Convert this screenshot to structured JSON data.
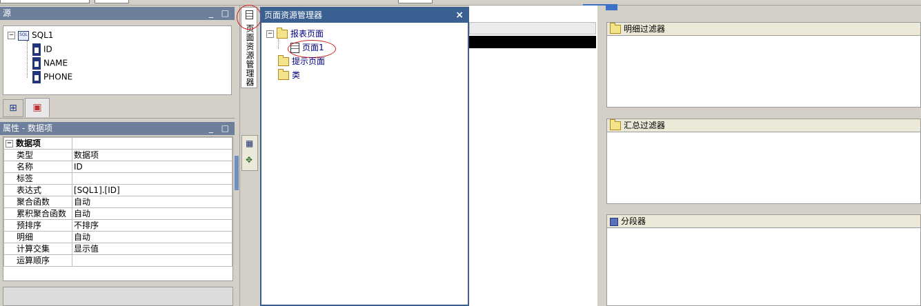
{
  "source_panel": {
    "title": "源",
    "datasource": "SQL1",
    "columns": [
      "ID",
      "NAME",
      "PHONE"
    ]
  },
  "properties_panel": {
    "title": "属性 - 数据项",
    "group": "数据项",
    "rows": [
      {
        "key": "类型",
        "value": "数据项"
      },
      {
        "key": "名称",
        "value": "ID"
      },
      {
        "key": "标签",
        "value": ""
      },
      {
        "key": "表达式",
        "value": "[SQL1].[ID]"
      },
      {
        "key": "聚合函数",
        "value": "自动"
      },
      {
        "key": "累积聚合函数",
        "value": "自动"
      },
      {
        "key": "预排序",
        "value": "不排序"
      },
      {
        "key": "明细",
        "value": "自动"
      },
      {
        "key": "计算交集",
        "value": "显示值"
      },
      {
        "key": "运算顺序",
        "value": ""
      }
    ]
  },
  "side_tab": {
    "label": "页面资源管理器"
  },
  "explorer": {
    "title": "页面资源管理器",
    "close": "×",
    "report_pages": "报表页面",
    "page1": "页面1",
    "prompt_pages": "提示页面",
    "classes": "类"
  },
  "filters": {
    "detail": "明细过滤器",
    "summary": "汇总过滤器",
    "slicer": "分段器"
  }
}
